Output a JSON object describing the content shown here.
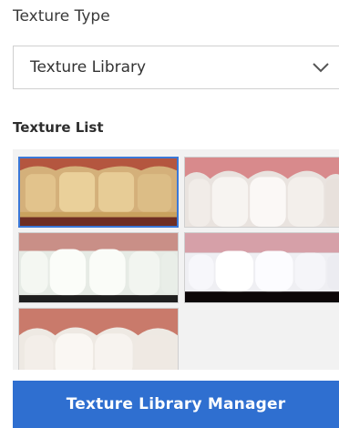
{
  "texture_type": {
    "label": "Texture Type",
    "selected_value": "Texture Library"
  },
  "texture_list": {
    "title": "Texture List",
    "thumbnails": [
      {
        "id": "thumb-1",
        "selected": true
      },
      {
        "id": "thumb-2",
        "selected": false
      },
      {
        "id": "thumb-3",
        "selected": false
      },
      {
        "id": "thumb-4",
        "selected": false
      },
      {
        "id": "thumb-5",
        "selected": false
      }
    ]
  },
  "actions": {
    "manager_button": "Texture Library Manager"
  },
  "colors": {
    "accent": "#2f6fd0",
    "selection_border": "#3a78d8"
  },
  "icons": {
    "dropdown": "chevron-down-icon"
  }
}
